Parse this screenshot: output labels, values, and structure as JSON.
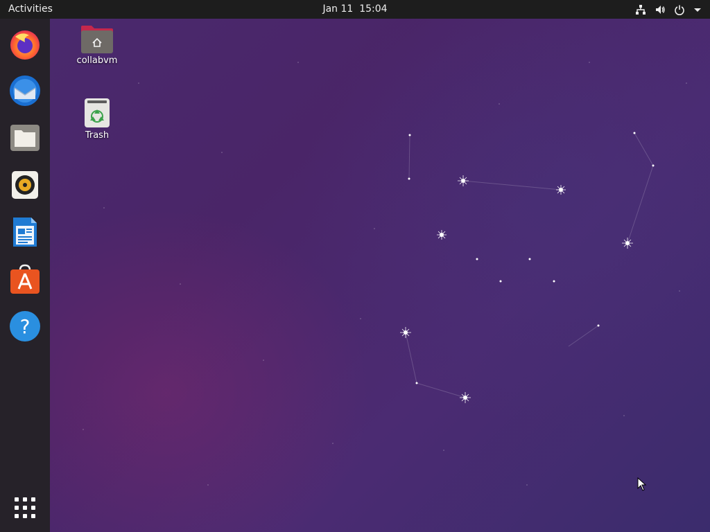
{
  "topbar": {
    "activities_label": "Activities",
    "date": "Jan 11",
    "time": "15:04",
    "tray_icons": [
      "network-icon",
      "volume-icon",
      "power-icon",
      "menu-arrow-icon"
    ]
  },
  "dock": {
    "apps": [
      {
        "name": "firefox",
        "icon": "firefox-icon"
      },
      {
        "name": "thunderbird",
        "icon": "thunderbird-icon"
      },
      {
        "name": "files",
        "icon": "files-icon"
      },
      {
        "name": "rhythmbox",
        "icon": "rhythmbox-icon"
      },
      {
        "name": "libreoffice-writer",
        "icon": "writer-icon"
      },
      {
        "name": "ubuntu-software",
        "icon": "software-icon"
      },
      {
        "name": "help",
        "icon": "help-icon"
      }
    ],
    "show_apps_icon": "grid-icon"
  },
  "desktop": {
    "icons": [
      {
        "label": "collabvm",
        "icon": "home-folder-icon"
      },
      {
        "label": "Trash",
        "icon": "trash-icon"
      }
    ]
  },
  "colors": {
    "topbar_bg": "#1d1d1d",
    "dock_bg": "#262229",
    "wallpaper_base": "#4a2a6e",
    "accent_orange": "#e95420"
  }
}
